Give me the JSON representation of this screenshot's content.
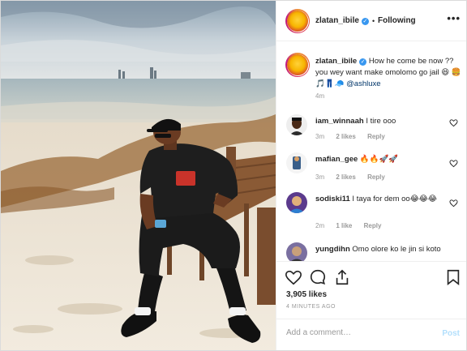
{
  "post": {
    "username": "zlatan_ibile",
    "verified_glyph": "✓",
    "separator": "•",
    "follow_status": "Following",
    "more_glyph": "•••",
    "caption": {
      "username": "zlatan_ibile",
      "text": "How he come be now ?? you wey want make omolomo go jail 😆 🍔🎵👖🧢",
      "mention": "@ashluxe",
      "time": "4m"
    },
    "comments": [
      {
        "username": "iam_winnaah",
        "text": "I tire ooo",
        "time": "3m",
        "likes": "2 likes",
        "reply": "Reply"
      },
      {
        "username": "mafian_gee",
        "text": "🔥🔥🚀🚀",
        "time": "3m",
        "likes": "2 likes",
        "reply": "Reply"
      },
      {
        "username": "sodiski11",
        "text": "I taya for dem oo😂😂😂",
        "time": "2m",
        "likes": "1 like",
        "reply": "Reply"
      },
      {
        "username": "yungdihn",
        "text": "Omo olore ko le jin si koto",
        "time": "",
        "likes": "",
        "reply": ""
      }
    ],
    "likes_count": "3,905 likes",
    "posted_ago": "4 MINUTES AGO",
    "add_comment_placeholder": "Add a comment…",
    "post_button": "Post"
  },
  "icons": {
    "verified": "verified-badge-icon",
    "like": "heart-icon",
    "comment": "comment-icon",
    "share": "share-icon",
    "save": "bookmark-icon"
  },
  "colors": {
    "accent": "#3897f0",
    "muted": "#999999",
    "post_button_disabled": "#b2dffc"
  }
}
